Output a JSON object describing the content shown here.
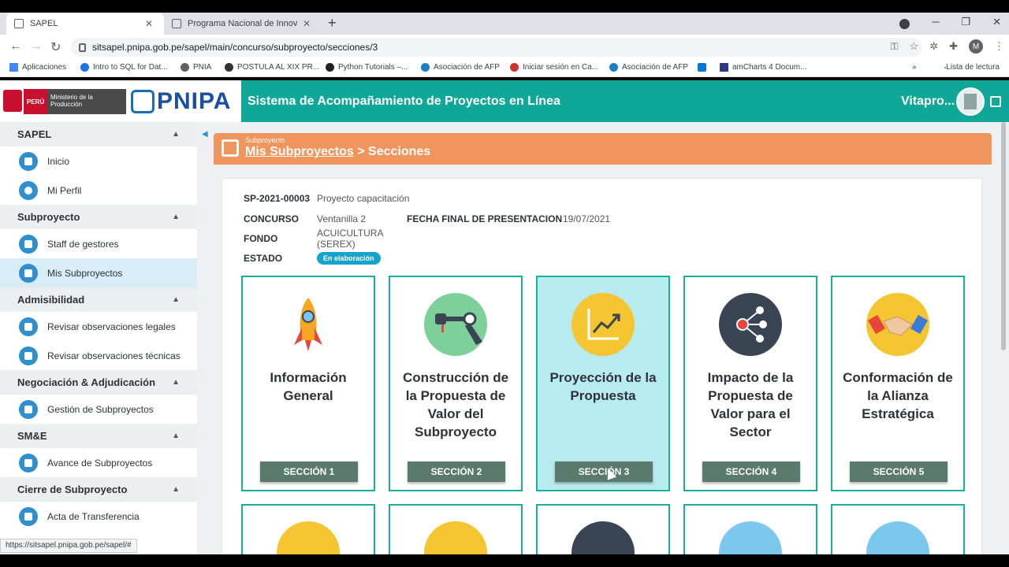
{
  "browser": {
    "tabs": [
      {
        "label": "SAPEL",
        "active": true
      },
      {
        "label": "Programa Nacional de Innovació",
        "active": false
      }
    ],
    "url": "sitsapel.pnipa.gob.pe/sapel/main/concurso/subproyecto/secciones/3",
    "bookmarks": [
      "Aplicaciones",
      "Intro to SQL for Dat...",
      "PNIA",
      "POSTULA AL XIX PR...",
      "Python Tutorials –...",
      "Asociación de AFP",
      "Iniciar sesión en Ca...",
      "Asociación de AFP",
      "amCharts 4 Docum..."
    ],
    "reading_list": "Lista de lectura",
    "profile_initial": "M",
    "status_url": "https://sitsapel.pnipa.gob.pe/sapel/#"
  },
  "header": {
    "peru_label": "PERÚ",
    "ministry_label": "Ministerio de la Producción",
    "logo_text": "PNIPA",
    "app_title": "Sistema de Acompañamiento de Proyectos en Línea",
    "user_name": "Vitapro..."
  },
  "sidebar": {
    "sections": [
      {
        "title": "SAPEL",
        "items": [
          "Inicio",
          "Mi Perfil"
        ]
      },
      {
        "title": "Subproyecto",
        "items": [
          "Staff de gestores",
          "Mis Subproyectos"
        ]
      },
      {
        "title": "Admisibilidad",
        "items": [
          "Revisar observaciones legales",
          "Revisar observaciones técnicas"
        ]
      },
      {
        "title": "Negociación & Adjudicación",
        "items": [
          "Gestión de Subproyectos"
        ]
      },
      {
        "title": "SM&E",
        "items": [
          "Avance de Subproyectos"
        ]
      },
      {
        "title": "Cierre de Subproyecto",
        "items": [
          "Acta de Transferencia"
        ]
      }
    ],
    "active_item": "Mis Subproyectos"
  },
  "content": {
    "subtitle": "Subproyecto",
    "breadcrumb_link": "Mis Subproyectos",
    "breadcrumb_current": "> Secciones",
    "project_code": "SP-2021-00003",
    "project_name": "Proyecto capacitación",
    "concurso_label": "CONCURSO",
    "concurso_value": "Ventanilla 2",
    "fecha_label": "FECHA FINAL DE PRESENTACION",
    "fecha_value": "19/07/2021",
    "fondo_label": "FONDO",
    "fondo_value": "ACUICULTURA (SEREX)",
    "estado_label": "ESTADO",
    "estado_value": "En elaboración",
    "cards": [
      {
        "title": "Información General",
        "button": "SECCIÓN 1",
        "icon": "rocket-icon",
        "color": "#ffffff"
      },
      {
        "title": "Construcción de la Propuesta de Valor del Subproyecto",
        "button": "SECCIÓN 2",
        "icon": "robot-arm-icon",
        "color": "#7ed09b"
      },
      {
        "title": "Proyección de la Propuesta",
        "button": "SECCIÓN 3",
        "icon": "growth-chart-icon",
        "color": "#f5c431"
      },
      {
        "title": "Impacto de la Propuesta de Valor para el Sector",
        "button": "SECCIÓN 4",
        "icon": "network-icon",
        "color": "#3a4553"
      },
      {
        "title": "Conformación de la Alianza Estratégica",
        "button": "SECCIÓN 5",
        "icon": "handshake-icon",
        "color": "#f5c431"
      }
    ],
    "active_card": 2,
    "second_row_icons": [
      {
        "icon": "refresh-icon",
        "color": "#f5c431"
      },
      {
        "icon": "trophy-icon",
        "color": "#f5c431"
      },
      {
        "icon": "document-icon",
        "color": "#3a4553"
      },
      {
        "icon": "water-drop-icon",
        "color": "#7cc7ec"
      },
      {
        "icon": "bar-chart-icon",
        "color": "#7cc7ec"
      }
    ]
  },
  "colors": {
    "topbar": "#0fa898",
    "header_orange": "#f0955b",
    "card_border": "#18b09d",
    "button": "#5a7a6e"
  }
}
